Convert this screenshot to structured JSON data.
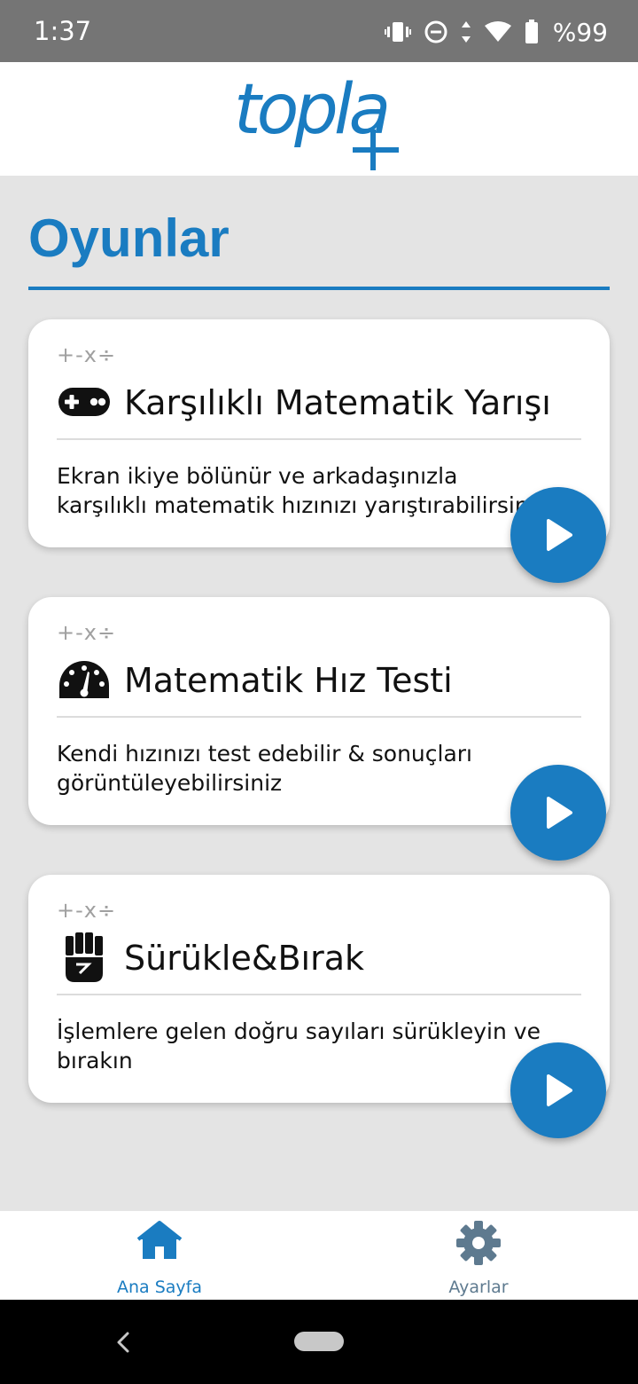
{
  "status_bar": {
    "time": "1:37",
    "battery": "%99",
    "icons": [
      "vibrate-icon",
      "do-not-disturb-icon",
      "data-arrows-icon",
      "wifi-icon",
      "battery-icon"
    ]
  },
  "header": {
    "logo_text": "topla",
    "logo_mark": "plus-icon"
  },
  "section": {
    "title": "Oyunlar"
  },
  "games": [
    {
      "ops": "+-x÷",
      "icon": "gamepad-icon",
      "title": "Karşılıklı Matematik Yarışı",
      "description": "Ekran ikiye bölünür ve arkadaşınızla karşılıklı matematik hızınızı yarıştırabilirsiniz"
    },
    {
      "ops": "+-x÷",
      "icon": "speedometer-icon",
      "title": "Matematik Hız Testi",
      "description": "Kendi hızınızı test edebilir & sonuçları görüntüleyebilirsiniz"
    },
    {
      "ops": "+-x÷",
      "icon": "fist-icon",
      "title": "Sürükle&Bırak",
      "description": "İşlemlere gelen doğru sayıları sürükleyin ve bırakın"
    }
  ],
  "bottom_nav": {
    "items": [
      {
        "label": "Ana Sayfa",
        "icon": "home-icon",
        "active": true
      },
      {
        "label": "Ayarlar",
        "icon": "gear-icon",
        "active": false
      }
    ]
  },
  "colors": {
    "accent": "#1a7cc1",
    "background": "#e4e4e4",
    "status_bar": "#757575",
    "inactive_nav": "#5e7a8f"
  }
}
